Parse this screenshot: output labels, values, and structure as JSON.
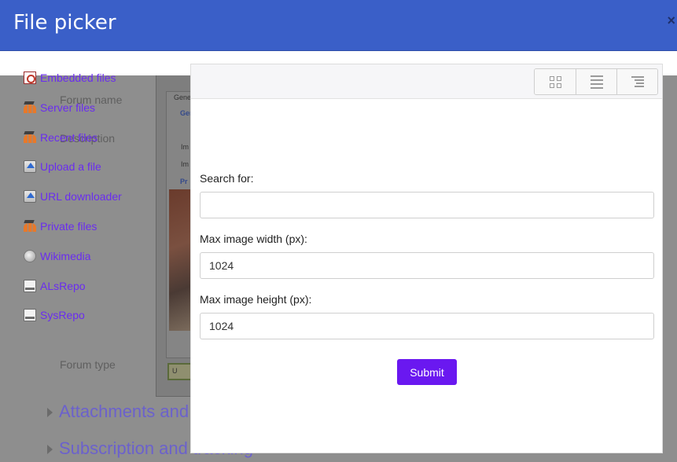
{
  "dialog": {
    "title": "File picker",
    "close_glyph": "×"
  },
  "background_page": {
    "labels": [
      "Forum name",
      "Description",
      "Forum type"
    ],
    "sections": [
      "Attachments and word count",
      "Subscription and tracking"
    ],
    "editor_tags": [
      "Gene",
      "Gen",
      "Im",
      "Im",
      "Pr",
      "U"
    ]
  },
  "repositories": [
    {
      "label": "Embedded files",
      "icon": "embedded-file-icon"
    },
    {
      "label": "Server files",
      "icon": "moodle-hat-icon"
    },
    {
      "label": "Recent files",
      "icon": "moodle-hat-icon"
    },
    {
      "label": "Upload a file",
      "icon": "upload-icon"
    },
    {
      "label": "URL downloader",
      "icon": "upload-icon"
    },
    {
      "label": "Private files",
      "icon": "moodle-hat-icon"
    },
    {
      "label": "Wikimedia",
      "icon": "wikimedia-globe-icon"
    },
    {
      "label": "ALsRepo",
      "icon": "repository-icon"
    },
    {
      "label": "SysRepo",
      "icon": "repository-icon"
    }
  ],
  "toolbar": {
    "views": [
      "icons-view",
      "list-view",
      "tree-view"
    ]
  },
  "form": {
    "search_label": "Search for:",
    "search_value": "",
    "max_width_label": "Max image width (px):",
    "max_width_value": "1024",
    "max_height_label": "Max image height (px):",
    "max_height_value": "1024",
    "submit_label": "Submit"
  },
  "colors": {
    "header": "#3a5fc8",
    "link": "#6a2cf0",
    "submit": "#6a18f0"
  }
}
